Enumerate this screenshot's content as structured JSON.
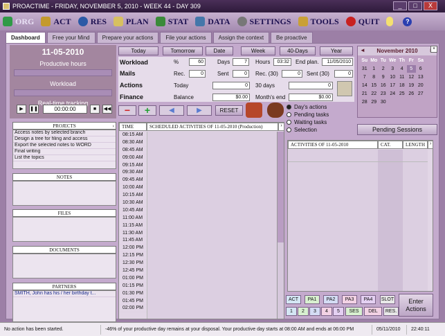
{
  "window": {
    "title": "PROACTIME - FRIDAY, NOVEMBER 5, 2010 - WEEK 44 - DAY 309",
    "min": "_",
    "max": "□",
    "close": "X"
  },
  "menu": {
    "items": [
      {
        "label": "ORG",
        "icon": "org-icon",
        "color": "#2f9a46"
      },
      {
        "label": "ACT",
        "icon": "act-icon",
        "color": "#c49a2c"
      },
      {
        "label": "RES",
        "icon": "res-icon",
        "color": "#2b5aa6"
      },
      {
        "label": "PLAN",
        "icon": "plan-icon",
        "color": "#d7c060"
      },
      {
        "label": "STAT",
        "icon": "stat-icon",
        "color": "#3a8a3a"
      },
      {
        "label": "DATA",
        "icon": "data-icon",
        "color": "#4477aa"
      },
      {
        "label": "SETTINGS",
        "icon": "settings-icon",
        "color": "#777777"
      },
      {
        "label": "TOOLS",
        "icon": "tools-icon",
        "color": "#c9a035"
      },
      {
        "label": "QUIT",
        "icon": "quit-icon",
        "color": "#c82020"
      }
    ],
    "help_icon": "help-icon",
    "idea_icon": "lightbulb-icon"
  },
  "tabs": [
    "Dashboard",
    "Free your Mind",
    "Prepare your actions",
    "File your actions",
    "Assign the context",
    "Be proactive"
  ],
  "left": {
    "date": "11-05-2010",
    "productive_label": "Productive hours",
    "workload_label": "Workload",
    "tracking_label": "Real-time tracking",
    "timer": "00:00:00",
    "projects_header": "PROJECTS",
    "projects": [
      "Access notes by selected branch",
      "Design a tree for filing and access",
      "Export the selected notes to WORD",
      "Final writing",
      "List the topics"
    ],
    "notes_header": "NOTES",
    "files_header": "FILES",
    "documents_header": "DOCUMENTS",
    "partners_header": "PARTNERS",
    "partners": [
      "SMITH, John has his / her birthday t..."
    ]
  },
  "nav": {
    "buttons": [
      "Today",
      "Tomorrow",
      "Date",
      "Week",
      "40-Days",
      "Year"
    ]
  },
  "stats": {
    "workload": "Workload",
    "pct_label": "%",
    "pct": "60",
    "days_label": "Days",
    "days": "7",
    "hours_label": "Hours",
    "hours": "03:32",
    "endplan_label": "End plan.",
    "endplan": "11/05/2010",
    "mails": "Mails",
    "rec_label": "Rec.",
    "rec": "0",
    "sent_label": "Sent",
    "sent": "0",
    "rec30_label": "Rec. (30)",
    "rec30": "0",
    "sent30_label": "Sent (30)",
    "sent30": "0",
    "actions": "Actions",
    "today_label": "Today",
    "today": "0",
    "d30_label": "30 days",
    "d30": "0",
    "finance": "Finance",
    "balance_label": "Balance",
    "balance": "$0.00",
    "monthend_label": "Month's end",
    "monthend": "$0.00"
  },
  "toolbar": {
    "reset": "RESET"
  },
  "radios": [
    "Day's actions",
    "Pending tasks",
    "Waiting tasks",
    "Selection"
  ],
  "schedule": {
    "time_header": "TIME",
    "title_header": "SCHEDULED ACTIVITIES OF  11-05-2010 (Production)",
    "times": [
      "08:15 AM",
      "08:30 AM",
      "08:45 AM",
      "09:00 AM",
      "09:15 AM",
      "09:30 AM",
      "09:45 AM",
      "10:00 AM",
      "10:15 AM",
      "10:30 AM",
      "10:45 AM",
      "11:00 AM",
      "11:15 AM",
      "11:30 AM",
      "11:45 AM",
      "12:00 PM",
      "12:15 PM",
      "12:30 PM",
      "12:45 PM",
      "01:00 PM",
      "01:15 PM",
      "01:30 PM",
      "01:45 PM",
      "02:00 PM"
    ]
  },
  "calendar": {
    "month": "November 2010",
    "prev": "◄",
    "next": "►",
    "dow": [
      "Su",
      "Mo",
      "Tu",
      "We",
      "Th",
      "Fr",
      "Sa"
    ],
    "days": [
      "31",
      "1",
      "2",
      "3",
      "4",
      "5",
      "6",
      "7",
      "8",
      "9",
      "10",
      "11",
      "12",
      "13",
      "14",
      "15",
      "16",
      "17",
      "18",
      "19",
      "20",
      "21",
      "22",
      "23",
      "24",
      "25",
      "26",
      "27",
      "28",
      "29",
      "30",
      "",
      "",
      "",
      "",
      "",
      "",
      ""
    ]
  },
  "pending": {
    "label": "Pending Sessions"
  },
  "activities": {
    "title": "ACTIVITIES OF  11-05-2010",
    "cat": "CAT.",
    "length": "LENGTH"
  },
  "palette": {
    "row1": [
      "ACT",
      "PA1",
      "PA2",
      "PA3",
      "PA4",
      "SLOT"
    ],
    "row2": [
      "1",
      "2",
      "3",
      "4",
      "5",
      "SES",
      "DEL",
      "RES."
    ],
    "enter": "Enter Actions"
  },
  "status": {
    "msg1": "No action has been started.",
    "msg2": "-46% of your productive day remains at your disposal.  Your productive day starts at 08:00 AM and ends at 06:00 PM",
    "date": "05/11/2010",
    "time": "22:40:11"
  }
}
